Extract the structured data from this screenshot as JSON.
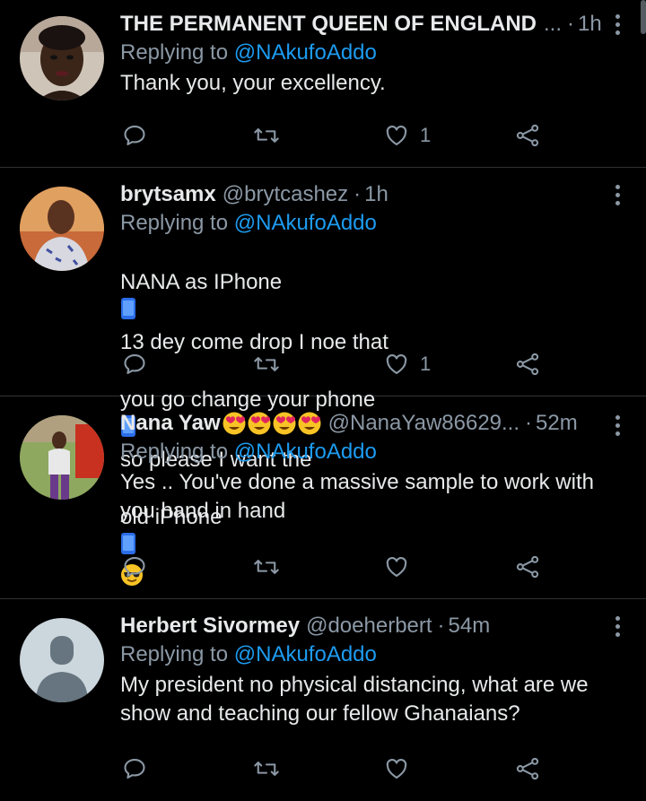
{
  "replying_prefix": "Replying to",
  "colors": {
    "background": "#000000",
    "text": "#e7e9ea",
    "muted": "#8b98a5",
    "link": "#1d9bf0",
    "divider": "#2f3336"
  },
  "tweets": [
    {
      "name": "THE PERMANENT QUEEN OF ENGLAND",
      "truncation": "...",
      "handle": "",
      "time": "1h",
      "replying_to": "@NAkufoAddo",
      "text": "Thank you, your excellency.",
      "likes": "1",
      "avatar_icon": "woman-portrait-avatar"
    },
    {
      "name": "brytsamx",
      "handle": "@brytcashez",
      "time": "1h",
      "replying_to": "@NAkufoAddo",
      "text_parts": [
        "NANA as IPhone",
        "13 dey come drop I noe that",
        "you go change your phone",
        "so please I want the",
        "old iPhone"
      ],
      "likes": "1",
      "avatar_icon": "man-portrait-avatar"
    },
    {
      "name": "Nana Yaw",
      "name_emoji_count": 4,
      "handle": "@NanaYaw86629...",
      "time": "52m",
      "replying_to": "@NAkufoAddo",
      "text": "Yes .. You've done a massive sample to work with\nyou hand in hand",
      "likes": "",
      "avatar_icon": "man-standing-avatar"
    },
    {
      "name": "Herbert Sivormey",
      "handle": "@doeherbert",
      "time": "54m",
      "replying_to": "@NAkufoAddo",
      "text": "My president no physical distancing, what are we\nshow and teaching our fellow Ghanaians?",
      "likes": "",
      "avatar_icon": "default-person-avatar"
    }
  ]
}
